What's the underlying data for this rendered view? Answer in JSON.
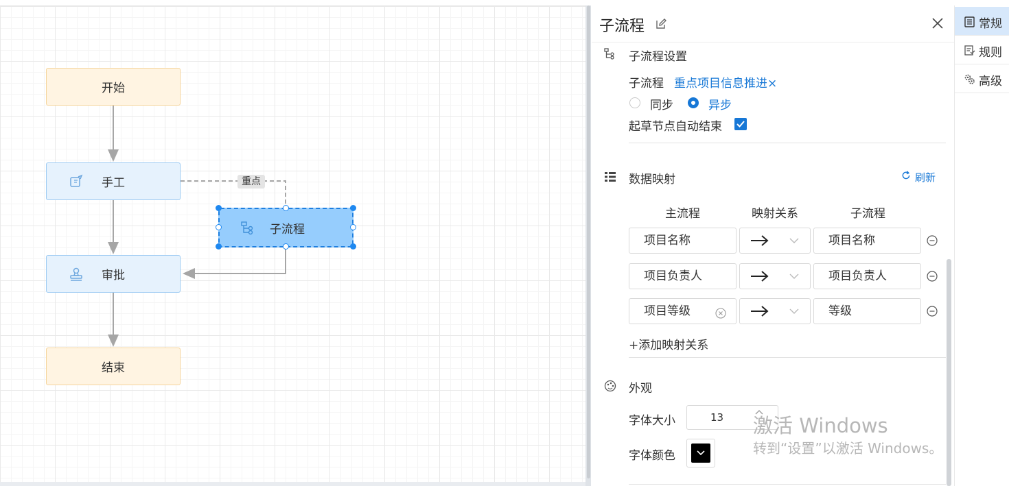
{
  "canvas": {
    "nodes": {
      "start": "开始",
      "manual": "手工",
      "approve": "审批",
      "end": "结束",
      "subprocess": "子流程"
    },
    "edge_label": "重点"
  },
  "panel": {
    "title": "子流程",
    "subprocess_section": {
      "title": "子流程设置",
      "subprocess_label": "子流程",
      "subprocess_value": "重点项目信息推进×",
      "mode_options": [
        "同步",
        "异步"
      ],
      "mode_selected": "异步",
      "auto_end_label": "起草节点自动结束",
      "auto_end_checked": true
    },
    "mapping_section": {
      "title": "数据映射",
      "refresh_label": "刷新",
      "columns": [
        "主流程",
        "映射关系",
        "子流程"
      ],
      "rows": [
        {
          "main": "项目名称",
          "relation": "→",
          "sub": "项目名称"
        },
        {
          "main": "项目负责人",
          "relation": "→",
          "sub": "项目负责人"
        },
        {
          "main": "项目等级",
          "relation": "→",
          "sub": "等级"
        }
      ],
      "add_label": "+添加映射关系"
    },
    "appearance_section": {
      "title": "外观",
      "font_size_label": "字体大小",
      "font_size_value": "13",
      "font_color_label": "字体颜色",
      "font_color": "#000000"
    }
  },
  "right_tabs": [
    {
      "label": "常规",
      "icon": "clipboard-icon",
      "active": true
    },
    {
      "label": "规则",
      "icon": "rules-icon",
      "active": false
    },
    {
      "label": "高级",
      "icon": "gears-icon",
      "active": false
    }
  ],
  "watermark": {
    "line1": "激活 Windows",
    "line2": "转到“设置”以激活 Windows。"
  },
  "colors": {
    "accent": "#1677d6",
    "selected_node": "#96cdfd",
    "start_end_node": "#fff4e2",
    "task_node": "#e6f2fd"
  }
}
